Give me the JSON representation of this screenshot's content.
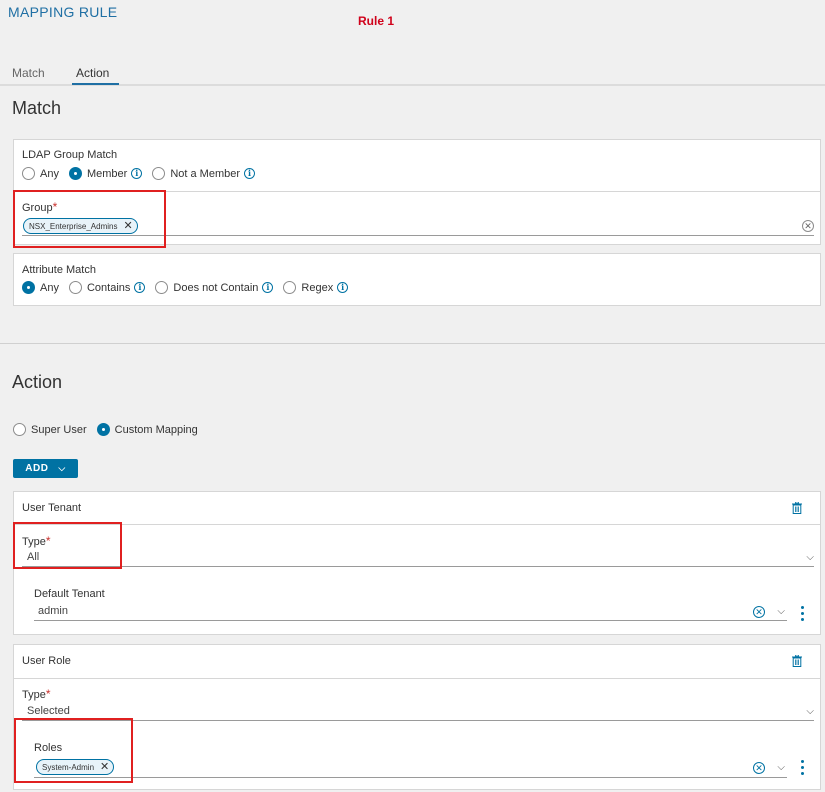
{
  "header": {
    "title": "MAPPING RULE",
    "rule_label": "Rule 1"
  },
  "tabs": [
    {
      "label": "Match",
      "active": false
    },
    {
      "label": "Action",
      "active": true
    }
  ],
  "match": {
    "section_title": "Match",
    "ldap": {
      "label": "LDAP Group Match",
      "options": [
        "Any",
        "Member",
        "Not a Member"
      ],
      "selected": "Member"
    },
    "group": {
      "label": "Group",
      "required_mark": "*",
      "chip": "NSX_Enterprise_Admins"
    },
    "attribute": {
      "label": "Attribute Match",
      "options": [
        "Any",
        "Contains",
        "Does not Contain",
        "Regex"
      ],
      "selected": "Any"
    }
  },
  "action": {
    "section_title": "Action",
    "mode_options": [
      "Super User",
      "Custom Mapping"
    ],
    "mode_selected": "Custom Mapping",
    "add_label": "ADD",
    "user_tenant": {
      "title": "User Tenant",
      "type_label": "Type",
      "required_mark": "*",
      "type_value": "All",
      "default_tenant_label": "Default Tenant",
      "default_tenant_value": "admin"
    },
    "user_role": {
      "title": "User Role",
      "type_label": "Type",
      "required_mark": "*",
      "type_value": "Selected",
      "roles_label": "Roles",
      "roles_chip": "System-Admin"
    }
  },
  "colors": {
    "accent": "#0072a3",
    "title_blue": "#1f6fa4",
    "highlight_red": "#e02020",
    "rule_red": "#d0021b"
  }
}
